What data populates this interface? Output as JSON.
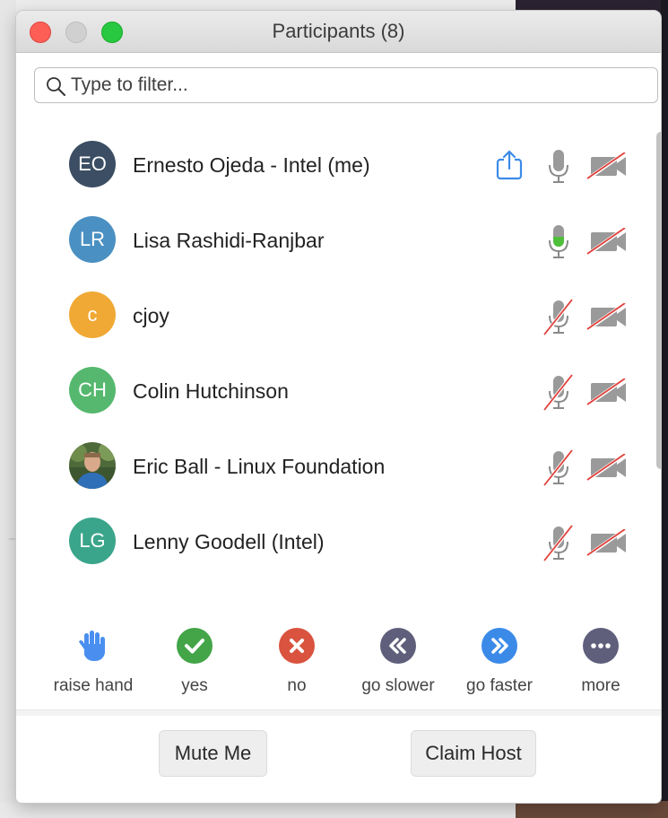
{
  "window": {
    "title": "Participants (8)"
  },
  "search": {
    "placeholder": "Type to filter..."
  },
  "participants": [
    {
      "initials": "EO",
      "name": "Ernesto Ojeda - Intel (me)",
      "avatar_color": "#3b4e63",
      "sharing": true,
      "mic": "on",
      "video": "off"
    },
    {
      "initials": "LR",
      "name": "Lisa Rashidi-Ranjbar",
      "avatar_color": "#4a90c2",
      "mic": "speaking",
      "video": "off"
    },
    {
      "initials": "c",
      "name": "cjoy",
      "avatar_color": "#f0a935",
      "mic": "muted",
      "video": "off"
    },
    {
      "initials": "CH",
      "name": "Colin Hutchinson",
      "avatar_color": "#55b86e",
      "mic": "muted",
      "video": "off"
    },
    {
      "initials": "",
      "name": "Eric Ball - Linux Foundation",
      "avatar_photo": true,
      "mic": "muted",
      "video": "off"
    },
    {
      "initials": "LG",
      "name": "Lenny Goodell (Intel)",
      "avatar_color": "#3aa58a",
      "mic": "muted",
      "video": "off"
    }
  ],
  "reactions": [
    {
      "label": "raise hand",
      "icon": "raised-hand-icon",
      "color": "#4a8ff0"
    },
    {
      "label": "yes",
      "icon": "checkmark-icon",
      "color": "#43a548"
    },
    {
      "label": "no",
      "icon": "x-icon",
      "color": "#d9533f"
    },
    {
      "label": "go slower",
      "icon": "double-chevron-left-icon",
      "color": "#5f5f7c"
    },
    {
      "label": "go faster",
      "icon": "double-chevron-right-icon",
      "color": "#3b8ae8"
    },
    {
      "label": "more",
      "icon": "ellipsis-icon",
      "color": "#5f5f7c"
    }
  ],
  "footer": {
    "mute_label": "Mute Me",
    "claim_host_label": "Claim Host"
  },
  "colors": {
    "accent": "#3b8ae8",
    "muted_slash": "#e0403a",
    "speaking": "#4fbf3a"
  }
}
